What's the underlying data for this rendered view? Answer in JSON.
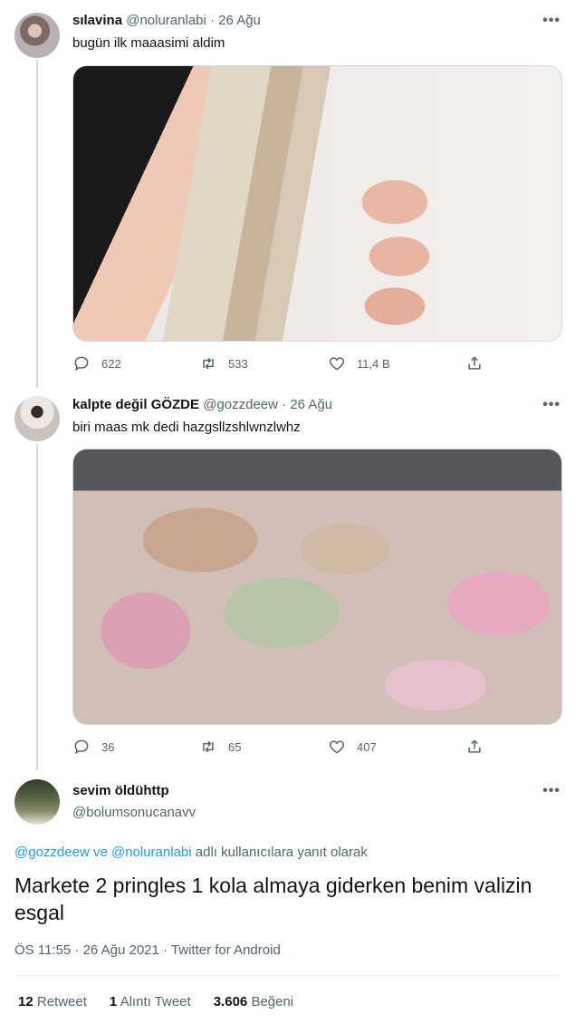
{
  "tweets": [
    {
      "display_name": "sılavina",
      "handle": "@noluranlabi",
      "date": "· 26 Ağu",
      "text": "bugün ilk maaasimi aldim",
      "replies": "622",
      "retweets": "533",
      "likes": "11,4 B"
    },
    {
      "display_name": "kalpte değil GÖZDE",
      "handle": "@gozzdeew",
      "date": "· 26 Ağu",
      "text": "biri maas mk dedi hazgsllzshlwnzlwhz",
      "replies": "36",
      "retweets": "65",
      "likes": "407"
    }
  ],
  "main_tweet": {
    "display_name": "sevim öldühttp",
    "handle": "@bolumsonucanavv",
    "reply_user1": "@gozzdeew",
    "reply_and": " ve ",
    "reply_user2": "@noluranlabi",
    "reply_suffix": " adlı kullanıcılara yanıt olarak",
    "text": "Markete 2 pringles 1 kola almaya giderken benim valizin esgal",
    "meta": "ÖS 11:55 · 26 Ağu 2021 · Twitter for Android",
    "retweet_count": "12",
    "retweet_label": "Retweet",
    "quote_count": "1",
    "quote_label": "Alıntı Tweet",
    "like_count": "3.606",
    "like_label": "Beğeni"
  },
  "icons": {
    "more": "more-dots-icon",
    "reply": "reply-icon",
    "retweet": "retweet-icon",
    "like": "heart-icon",
    "share": "share-icon"
  },
  "colors": {
    "link": "#1d9bf0",
    "muted": "#536471",
    "text": "#0f1419"
  }
}
